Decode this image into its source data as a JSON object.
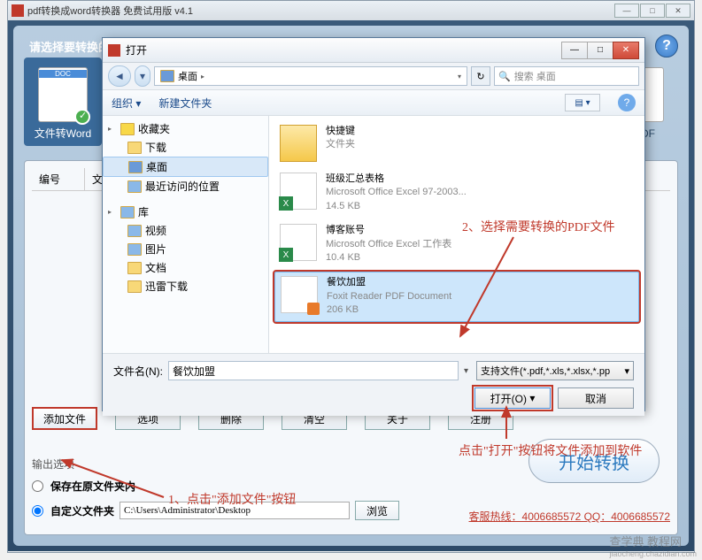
{
  "app": {
    "title": "pdf转换成word转换器 免费试用版 v4.1",
    "prompt": "请选择要转换的",
    "help_tooltip": "?"
  },
  "format_tabs": {
    "word": {
      "label": "文件转Word",
      "doc": "DOC"
    },
    "pdf": {
      "label": "转PDF"
    }
  },
  "table": {
    "col_id": "编号",
    "col_file": "文件"
  },
  "actions": {
    "add_file": "添加文件",
    "options": "选项",
    "delete": "删除",
    "clear": "清空",
    "about": "关于",
    "register": "注册"
  },
  "output": {
    "title": "输出选项",
    "radio_original": "保存在原文件夹内",
    "radio_custom": "自定义文件夹",
    "path": "C:\\Users\\Administrator\\Desktop",
    "browse": "浏览",
    "start": "开始转换",
    "hotline": "客服热线：4006685572 QQ：4006685572"
  },
  "dialog": {
    "title": "打开",
    "min": "—",
    "max": "□",
    "close": "✕",
    "nav": {
      "back": "◄",
      "fwd": "▾",
      "breadcrumb": "桌面",
      "search_placeholder": "搜索 桌面",
      "refresh": "↻"
    },
    "toolbar": {
      "organize": "组织 ▾",
      "new_folder": "新建文件夹",
      "view": "▤ ▾",
      "help": "?"
    },
    "tree": {
      "favorites": "收藏夹",
      "downloads": "下载",
      "desktop": "桌面",
      "recent": "最近访问的位置",
      "library": "库",
      "videos": "视频",
      "pictures": "图片",
      "documents": "文档",
      "thunder": "迅雷下载"
    },
    "files": [
      {
        "name": "快捷键",
        "type": "文件夹",
        "size": "",
        "kind": "folder"
      },
      {
        "name": "班级汇总表格",
        "type": "Microsoft Office Excel 97-2003...",
        "size": "14.5 KB",
        "kind": "excel"
      },
      {
        "name": "博客账号",
        "type": "Microsoft Office Excel 工作表",
        "size": "10.4 KB",
        "kind": "excel"
      },
      {
        "name": "餐饮加盟",
        "type": "Foxit Reader PDF Document",
        "size": "206 KB",
        "kind": "pdf"
      }
    ],
    "footer": {
      "filename_label": "文件名(N):",
      "filename_value": "餐饮加盟",
      "filter": "支持文件(*.pdf,*.xls,*.xlsx,*.pp",
      "open": "打开(O)",
      "cancel": "取消"
    }
  },
  "annotations": {
    "step1": "1、点击\"添加文件\"按钮",
    "step2": "2、选择需要转换的PDF文件",
    "step3": "点击\"打开\"按钮将文件添加到软件"
  },
  "watermark": {
    "main": "查学典 教程网",
    "sub": "jiaocheng.chazidian.com"
  }
}
